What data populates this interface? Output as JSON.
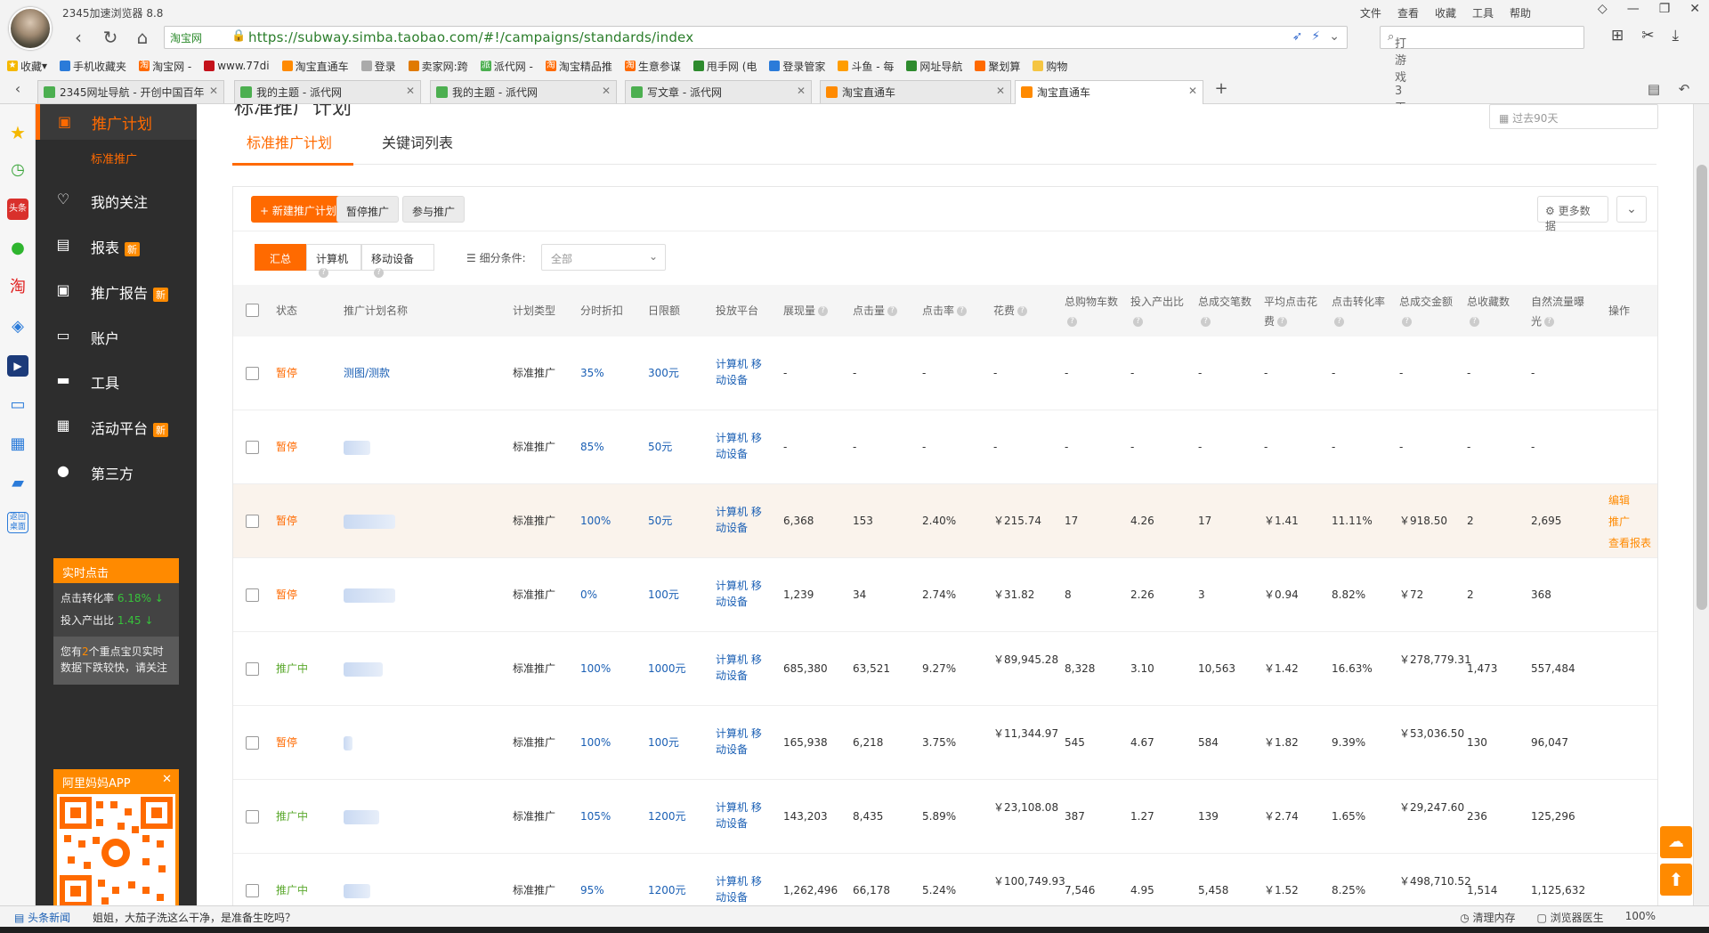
{
  "browser": {
    "app_title": "2345加速浏览器 8.8",
    "menu": [
      "文件",
      "查看",
      "收藏",
      "工具",
      "帮助"
    ],
    "address_site": "淘宝网",
    "url": "https://subway.simba.taobao.com/#!/campaigns/standards/index",
    "search_text": "打游戏3天3夜",
    "bookmarks": [
      "收藏",
      "手机收藏夹",
      "淘宝网 -",
      "www.77di",
      "淘宝直通车",
      "登录",
      "卖家网:跨",
      "派代网 -",
      "淘宝精品推",
      "生意参谋",
      "甩手网 (电",
      "登录管家",
      "斗鱼 - 每",
      "网址导航",
      "聚划算",
      "购物"
    ],
    "tabs": [
      {
        "label": "2345网址导航 - 开创中国百年"
      },
      {
        "label": "我的主题 - 派代网"
      },
      {
        "label": "我的主题 - 派代网"
      },
      {
        "label": "写文章 - 派代网"
      },
      {
        "label": "淘宝直通车"
      },
      {
        "label": "淘宝直通车"
      }
    ],
    "status_news": "头条新闻",
    "status_msg": "姐姐，大茄子洗这么干净，是准备生吃吗？",
    "status_right": [
      "清理内存",
      "浏览器医生",
      "100%"
    ]
  },
  "nav": {
    "top_label": "推广计划",
    "sub_label": "标准推广",
    "items": [
      {
        "label": "我的关注",
        "badge": ""
      },
      {
        "label": "报表",
        "badge": "新"
      },
      {
        "label": "推广报告",
        "badge": "新"
      },
      {
        "label": "账户",
        "badge": ""
      },
      {
        "label": "工具",
        "badge": ""
      },
      {
        "label": "活动平台",
        "badge": "新"
      },
      {
        "label": "第三方",
        "badge": ""
      }
    ],
    "realtime": {
      "title": "实时点击",
      "ctr_label": "点击转化率",
      "ctr_value": "6.18%",
      "roi_label": "投入产出比",
      "roi_value": "1.45",
      "note_pre": "您有",
      "note_num": "2",
      "note_post": "个重点宝贝实时数据下跌较快，请关注"
    },
    "app_promo": "阿里妈妈APP"
  },
  "main": {
    "page_title_partial": "标准推广计划",
    "date_range": "过去90天",
    "subtabs": [
      "标准推广计划",
      "关键词列表"
    ],
    "buttons": {
      "new_plan": "+ 新建推广计划",
      "pause": "暂停推广",
      "resume": "参与推广",
      "more_data": "更多数据"
    },
    "segments": [
      "汇总",
      "计算机",
      "移动设备"
    ],
    "filter_label": "细分条件:",
    "filter_value": "全部",
    "headers": [
      "状态",
      "推广计划名称",
      "计划类型",
      "分时折扣",
      "日限额",
      "投放平台",
      "展现量",
      "点击量",
      "点击率",
      "花费",
      "总购物车数",
      "投入产出比",
      "总成交笔数",
      "平均点击花费",
      "点击转化率",
      "总成交金额",
      "总收藏数",
      "自然流量曝光",
      "操作"
    ],
    "ops": [
      "编辑",
      "推广",
      "查看报表"
    ],
    "rows": [
      {
        "status": "暂停",
        "on": false,
        "name": "测图/测款",
        "type": "标准推广",
        "discount": "35%",
        "limit": "300元",
        "platform": "计算机 移动设备",
        "impr": "-",
        "clicks": "-",
        "ctr": "-",
        "cost": "-",
        "cart": "-",
        "roi": "-",
        "orders": "-",
        "cpc": "-",
        "cvr": "-",
        "gmv": "-",
        "fav": "-",
        "natural": "-"
      },
      {
        "status": "暂停",
        "on": false,
        "name": "",
        "type": "标准推广",
        "discount": "85%",
        "limit": "50元",
        "platform": "计算机 移动设备",
        "impr": "-",
        "clicks": "-",
        "ctr": "-",
        "cost": "-",
        "cart": "-",
        "roi": "-",
        "orders": "-",
        "cpc": "-",
        "cvr": "-",
        "gmv": "-",
        "fav": "-",
        "natural": "-"
      },
      {
        "status": "暂停",
        "on": false,
        "name": "",
        "type": "标准推广",
        "discount": "100%",
        "limit": "50元",
        "platform": "计算机 移动设备",
        "impr": "6,368",
        "clicks": "153",
        "ctr": "2.40%",
        "cost": "￥215.74",
        "cart": "17",
        "roi": "4.26",
        "orders": "17",
        "cpc": "￥1.41",
        "cvr": "11.11%",
        "gmv": "￥918.50",
        "fav": "2",
        "natural": "2,695"
      },
      {
        "status": "暂停",
        "on": false,
        "name": "",
        "type": "标准推广",
        "discount": "0%",
        "limit": "100元",
        "platform": "计算机 移动设备",
        "impr": "1,239",
        "clicks": "34",
        "ctr": "2.74%",
        "cost": "￥31.82",
        "cart": "8",
        "roi": "2.26",
        "orders": "3",
        "cpc": "￥0.94",
        "cvr": "8.82%",
        "gmv": "￥72",
        "fav": "2",
        "natural": "368"
      },
      {
        "status": "推广中",
        "on": true,
        "name": "",
        "type": "标准推广",
        "discount": "100%",
        "limit": "1000元",
        "platform": "计算机 移动设备",
        "impr": "685,380",
        "clicks": "63,521",
        "ctr": "9.27%",
        "cost": "￥89,945.28",
        "cart": "8,328",
        "roi": "3.10",
        "orders": "10,563",
        "cpc": "￥1.42",
        "cvr": "16.63%",
        "gmv": "￥278,779.31",
        "fav": "1,473",
        "natural": "557,484"
      },
      {
        "status": "暂停",
        "on": false,
        "name": "",
        "type": "标准推广",
        "discount": "100%",
        "limit": "100元",
        "platform": "计算机 移动设备",
        "impr": "165,938",
        "clicks": "6,218",
        "ctr": "3.75%",
        "cost": "￥11,344.97",
        "cart": "545",
        "roi": "4.67",
        "orders": "584",
        "cpc": "￥1.82",
        "cvr": "9.39%",
        "gmv": "￥53,036.50",
        "fav": "130",
        "natural": "96,047"
      },
      {
        "status": "推广中",
        "on": true,
        "name": "",
        "type": "标准推广",
        "discount": "105%",
        "limit": "1200元",
        "platform": "计算机 移动设备",
        "impr": "143,203",
        "clicks": "8,435",
        "ctr": "5.89%",
        "cost": "￥23,108.08",
        "cart": "387",
        "roi": "1.27",
        "orders": "139",
        "cpc": "￥2.74",
        "cvr": "1.65%",
        "gmv": "￥29,247.60",
        "fav": "236",
        "natural": "125,296"
      },
      {
        "status": "推广中",
        "on": true,
        "name": "",
        "type": "标准推广",
        "discount": "95%",
        "limit": "1200元",
        "platform": "计算机 移动设备",
        "impr": "1,262,496",
        "clicks": "66,178",
        "ctr": "5.24%",
        "cost": "￥100,749.93",
        "cart": "7,546",
        "roi": "4.95",
        "orders": "5,458",
        "cpc": "￥1.52",
        "cvr": "8.25%",
        "gmv": "￥498,710.52",
        "fav": "1,514",
        "natural": "1,125,632"
      }
    ]
  },
  "colors": {
    "accent": "#ff6a00",
    "status_on": "#5aa82c",
    "link": "#1a5fb4",
    "sidebar": "#2d2d2d"
  }
}
